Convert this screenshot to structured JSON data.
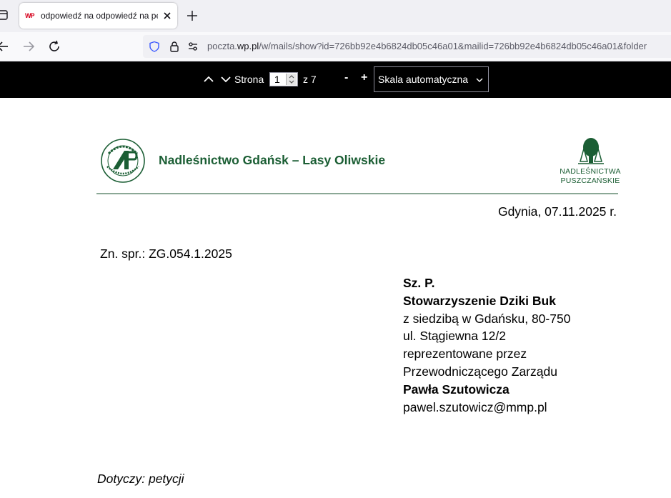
{
  "browser": {
    "tab": {
      "favicon_text": "WP",
      "title": "odpowiedź na odpowiedź na petycję"
    },
    "url": {
      "prefix": "poczta.",
      "host": "wp.pl",
      "path": "/w/mails/show?id=726bb92e4b6824db05c46a01&mailid=726bb92e4b6824db05c46a01&folder"
    }
  },
  "pdf_toolbar": {
    "page_label": "Strona",
    "current_page": "1",
    "of_label": "z 7",
    "zoom_out": "-",
    "zoom_in": "+",
    "scale": "Skala automatyczna"
  },
  "letter": {
    "header": {
      "org_name": "Nadleśnictwo Gdańsk – Lasy Oliwskie",
      "left_logo_text": "LASY PAŃSTWOWE",
      "right_logo_line1": "NADLEŚNICTWA",
      "right_logo_line2": "PUSZCZAŃSKIE"
    },
    "date": "Gdynia, 07.11.2025 r.",
    "reference": "Zn. spr.: ZG.054.1.2025",
    "addressee": {
      "salutation": "Sz. P.",
      "name": "Stowarzyszenie Dziki Buk",
      "line1": "z siedzibą w Gdańsku, 80-750",
      "line2": "ul. Stągiewna 12/2",
      "line3": "reprezentowane przez",
      "line4": "Przewodniczącego Zarządu",
      "person": "Pawła Szutowicza",
      "email": "pawel.szutowicz@mmp.pl"
    },
    "subject": "Dotyczy: petycji"
  },
  "colors": {
    "brand_green": "#1b5e34",
    "toolbar_bg": "#000000",
    "tabbar_bg": "#f0f0f4"
  }
}
